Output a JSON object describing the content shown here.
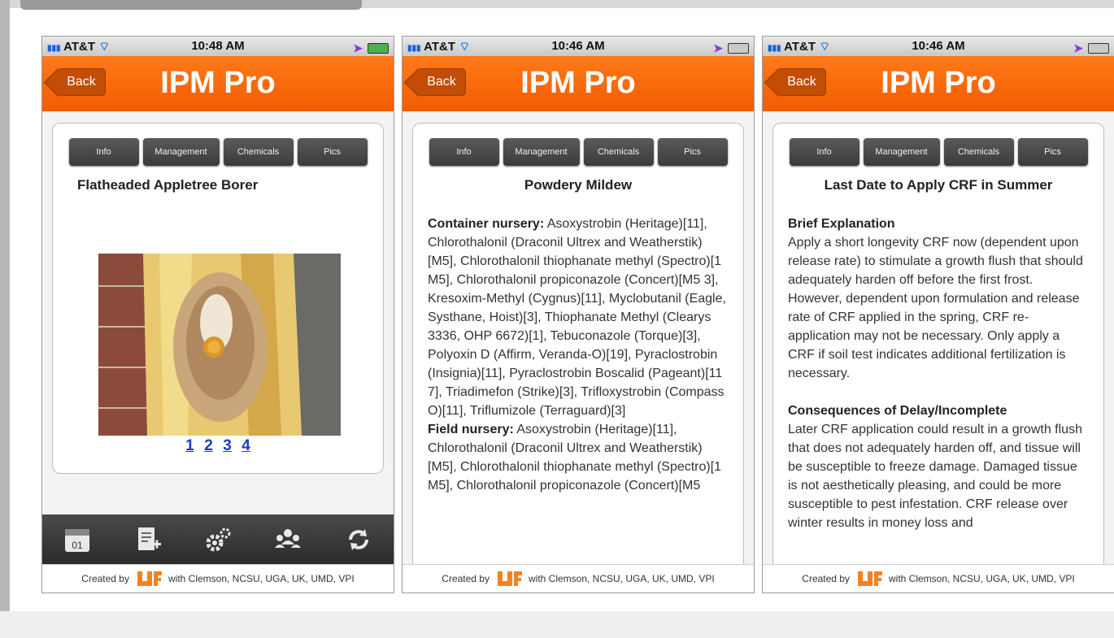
{
  "screens": [
    {
      "status": {
        "carrier": "AT&T",
        "time": "10:48 AM"
      },
      "nav": {
        "back": "Back",
        "title": "IPM Pro"
      },
      "tabs": [
        "Info",
        "Management",
        "Chemicals",
        "Pics"
      ],
      "title": "Flatheaded Appletree Borer",
      "pages": [
        "1",
        "2",
        "3",
        "4"
      ],
      "footer": {
        "prefix": "Created by",
        "suffix": "with Clemson, NCSU, UGA, UK, UMD, VPI"
      },
      "toolbar_icons": [
        "calendar-icon",
        "add-note-icon",
        "settings-icon",
        "users-icon",
        "sync-icon"
      ],
      "calendar_day": "01"
    },
    {
      "status": {
        "carrier": "AT&T",
        "time": "10:46 AM"
      },
      "nav": {
        "back": "Back",
        "title": "IPM Pro"
      },
      "tabs": [
        "Info",
        "Management",
        "Chemicals",
        "Pics"
      ],
      "title": "Powdery Mildew",
      "container_label": "Container nursery:",
      "container_text": " Asoxystrobin (Heritage)[11], Chlorothalonil (Draconil Ultrex and Weatherstik)[M5], Chlorothalonil thiophanate methyl (Spectro)[1 M5], Chlorothalonil propiconazole (Concert)[M5 3], Kresoxim-Methyl (Cygnus)[11], Myclobutanil (Eagle, Systhane, Hoist)[3], Thiophanate Methyl (Clearys 3336, OHP 6672)[1], Tebuconazole (Torque)[3], Polyoxin D (Affirm, Veranda-O)[19], Pyraclostrobin (Insignia)[11], Pyraclostrobin Boscalid (Pageant)[11 7], Triadimefon (Strike)[3], Trifloxystrobin (Compass O)[11], Triflumizole (Terraguard)[3]",
      "field_label": "Field nursery:",
      "field_text": " Asoxystrobin (Heritage)[11], Chlorothalonil (Draconil Ultrex and Weatherstik)[M5], Chlorothalonil thiophanate methyl (Spectro)[1 M5], Chlorothalonil propiconazole (Concert)[M5",
      "footer": {
        "prefix": "Created by",
        "suffix": "with Clemson, NCSU, UGA, UK, UMD, VPI"
      }
    },
    {
      "status": {
        "carrier": "AT&T",
        "time": "10:46 AM"
      },
      "nav": {
        "back": "Back",
        "title": "IPM Pro"
      },
      "tabs": [
        "Info",
        "Management",
        "Chemicals",
        "Pics"
      ],
      "title": "Last Date to Apply CRF in Summer",
      "section1_heading": "Brief Explanation",
      "section1_text": "Apply a short longevity CRF now (dependent upon release rate) to stimulate a growth flush that should adequately harden off before the first frost. However, dependent upon formulation and release rate of CRF applied in the spring, CRF re-application may not be necessary. Only apply a CRF if soil test indicates additional fertilization is necessary.",
      "section2_heading": "Consequences of Delay/Incomplete",
      "section2_text": "Later CRF application could result in a growth flush that does not adequately harden off, and tissue will be susceptible to freeze damage. Damaged tissue is not aesthetically pleasing, and could be more susceptible to pest infestation. CRF release over winter results in money loss and",
      "footer": {
        "prefix": "Created by",
        "suffix": "with Clemson, NCSU, UGA, UK, UMD, VPI"
      }
    }
  ],
  "colors": {
    "nav_orange": "#f25c00",
    "tab_dark": "#3b3b3b",
    "link_blue": "#1b3cc2"
  }
}
